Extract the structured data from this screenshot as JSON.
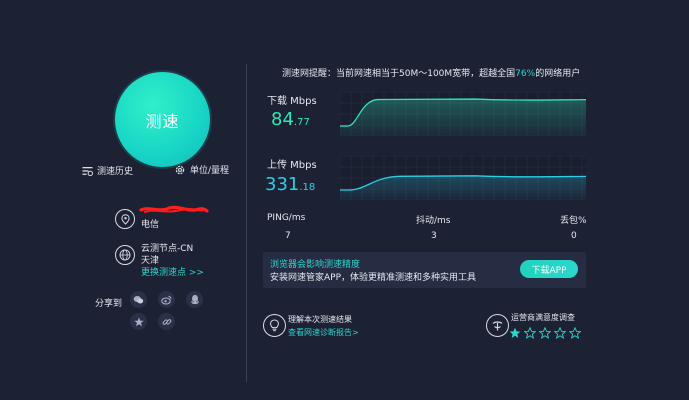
{
  "left": {
    "speed_button_label": "测速",
    "history_label": "测速历史",
    "units_label": "单位/量程",
    "isp_name": "电信",
    "node_label": "云测节点-CN",
    "node_city": "天津",
    "change_node_label": "更换测速点 >>",
    "share_label": "分享到"
  },
  "right": {
    "tip_prefix": "测速网提醒：当前网速相当于50M～100M宽带，超越全国",
    "tip_pct": "76%",
    "tip_suffix": "的网络用户",
    "download": {
      "label": "下载 Mbps",
      "int": "84",
      "dec": ".77",
      "level": 0.16
    },
    "upload": {
      "label": "上传 Mbps",
      "int": "331",
      "dec": ".18",
      "level": 0.45
    },
    "stats": [
      {
        "label": "PING/ms",
        "value": "7"
      },
      {
        "label": "抖动/ms",
        "value": "3"
      },
      {
        "label": "丢包%",
        "value": "0"
      }
    ],
    "promo_title": "浏览器会影响测速精度",
    "promo_sub": "安装网速管家APP，体验更精准测速和多种实用工具",
    "promo_button": "下载APP",
    "result_title": "理解本次测速结果",
    "result_link": "查看网速诊断报告>",
    "survey_title": "运营商满意度调查",
    "rating": 1,
    "rating_max": 5
  },
  "colors": {
    "accent": "#2ad7cf",
    "download": "#2fe6b9",
    "upload": "#2ad0e6",
    "bg": "#1c2133"
  }
}
